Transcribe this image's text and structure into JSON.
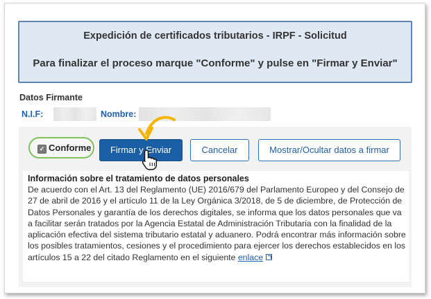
{
  "header": {
    "title": "Expedición de certificados tributarios - IRPF - Solicitud",
    "instruction": "Para finalizar el proceso marque \"Conforme\" y pulse en \"Firmar y Enviar\""
  },
  "firmante": {
    "section_title": "Datos Firmante",
    "nif_label": "N.I.F:",
    "nombre_label": "Nombre:"
  },
  "actions": {
    "conforme_label": "Conforme",
    "conforme_checked": true,
    "sign_label": "Firmar y Enviar",
    "cancel_label": "Cancelar",
    "toggle_label": "Mostrar/Ocultar datos a firmar"
  },
  "info": {
    "title": "Información sobre el tratamiento de datos personales",
    "body": "De acuerdo con el Art. 13 del Reglamento (UE) 2016/679 del Parlamento Europeo y del Consejo de 27 de abril de 2016 y el artículo 11 de la Ley Orgánica 3/2018, de 5 de diciembre, de Protección de Datos Personales y garantía de los derechos digitales, se informa que los datos personales que va a facilitar serán tratados por la Agencia Estatal de Administración Tributaria con la finalidad de la aplicación efectiva del sistema tributario estatal y aduanero. Podrá encontrar más información sobre los posibles tratamientos, cesiones y el procedimiento para ejercer los derechos establecidos en los artículos 15 a 22 del citado Reglamento en el siguiente",
    "link_label": "enlace"
  },
  "colors": {
    "primary": "#1a5fa6",
    "header_bg": "#dfe9f3",
    "header_border": "#5f86b0",
    "highlight_green": "#7dc35a",
    "arrow_yellow": "#f4b400"
  },
  "icons": {
    "external_link": "external-link-icon",
    "arrow": "curved-arrow-icon",
    "cursor": "hand-pointer-icon"
  }
}
